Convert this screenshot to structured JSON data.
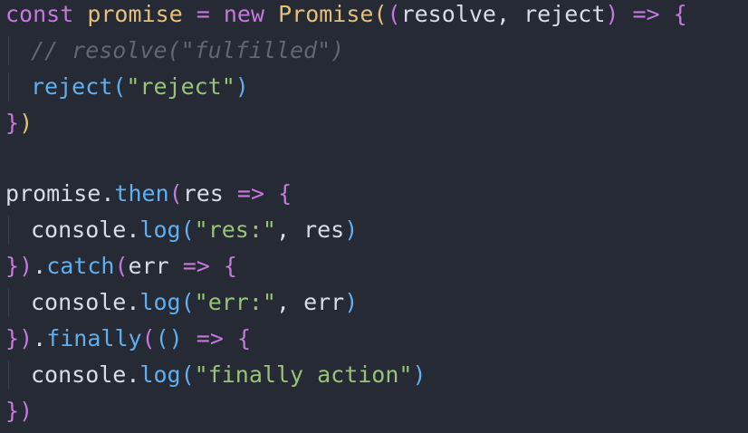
{
  "code": {
    "line1": {
      "kw_const": "const",
      "var_promise": "promise",
      "eq": "=",
      "kw_new": "new",
      "cls_promise": "Promise",
      "paren_open": "(",
      "args_open": "(",
      "param_resolve": "resolve",
      "comma": ",",
      "param_reject": "reject",
      "args_close": ")",
      "arrow": "=>",
      "brace_open": "{"
    },
    "line2": {
      "comment": "// resolve(\"fulfilled\")"
    },
    "line3": {
      "fn_reject": "reject",
      "paren_open": "(",
      "str_reject": "\"reject\"",
      "paren_close": ")"
    },
    "line4": {
      "brace_close": "}",
      "paren_close": ")"
    },
    "line6": {
      "obj": "promise",
      "dot": ".",
      "method": "then",
      "paren_open": "(",
      "param": "res",
      "arrow": "=>",
      "brace_open": "{"
    },
    "line7": {
      "obj": "console",
      "dot": ".",
      "method": "log",
      "paren_open": "(",
      "str": "\"res:\"",
      "comma": ",",
      "arg": "res",
      "paren_close": ")"
    },
    "line8": {
      "brace_close": "}",
      "paren_close": ")",
      "dot": ".",
      "method": "catch",
      "paren_open": "(",
      "param": "err",
      "arrow": "=>",
      "brace_open": "{"
    },
    "line9": {
      "obj": "console",
      "dot": ".",
      "method": "log",
      "paren_open": "(",
      "str": "\"err:\"",
      "comma": ",",
      "arg": "err",
      "paren_close": ")"
    },
    "line10": {
      "brace_close": "}",
      "paren_close": ")",
      "dot": ".",
      "method": "finally",
      "paren_open": "(",
      "args": "()",
      "arrow": "=>",
      "brace_open": "{"
    },
    "line11": {
      "obj": "console",
      "dot": ".",
      "method": "log",
      "paren_open": "(",
      "str": "\"finally action\"",
      "paren_close": ")"
    },
    "line12": {
      "brace_close": "}",
      "paren_close": ")"
    }
  },
  "colors": {
    "background": "#252a34",
    "keyword": "#c678dd",
    "variable": "#e5c07b",
    "function": "#61afef",
    "string": "#98c379",
    "comment": "#5f6775",
    "text": "#d6dde8"
  }
}
